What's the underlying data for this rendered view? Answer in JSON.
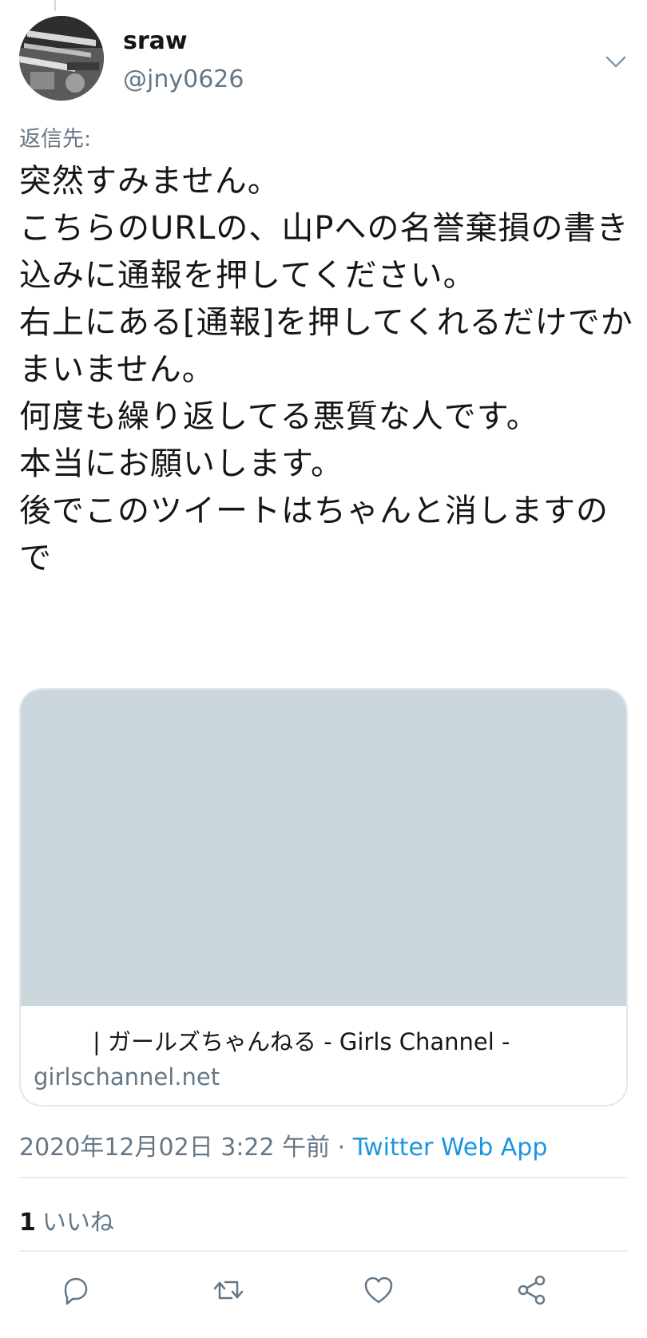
{
  "tweet": {
    "display_name": "sraw",
    "handle": "@jny0626",
    "reply_to_label": "返信先:",
    "text": "突然すみません。\nこちらのURLの、山Pへの名誉棄損の書き込みに通報を押してください。\n右上にある[通報]を押してくれるだけでかまいません。\n何度も繰り返してる悪質な人です。\n本当にお願いします。\n後でこのツイートはちゃんと消しますので",
    "timestamp": "2020年12月02日 3:22 午前",
    "separator": " · ",
    "source": "Twitter Web App",
    "like_count": "1",
    "like_label": "いいね"
  },
  "card": {
    "title": "| ガールズちゃんねる - Girls Channel -",
    "domain": "girlschannel.net"
  },
  "icons": {
    "caret": "chevron-down-icon",
    "reply": "reply-icon",
    "retweet": "retweet-icon",
    "like": "heart-icon",
    "share": "share-icon"
  },
  "colors": {
    "text": "#14171a",
    "secondary": "#657786",
    "link": "#1b95e0",
    "card_placeholder": "#ccd6dd",
    "border": "#e1e8ed"
  }
}
